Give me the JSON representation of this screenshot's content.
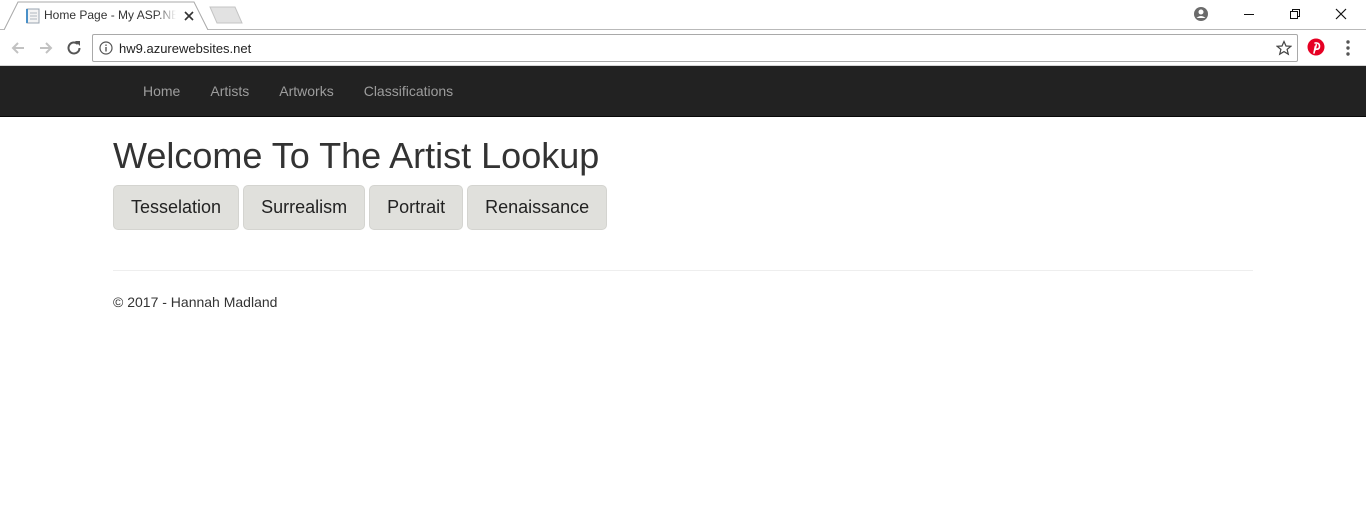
{
  "browser": {
    "tab_title": "Home Page - My ASP.NET Application",
    "url": "hw9.azurewebsites.net",
    "icons": {
      "back": "back-arrow-icon",
      "forward": "forward-arrow-icon",
      "reload": "reload-icon",
      "info": "info-icon",
      "bookmark": "star-icon",
      "extension": "pinterest-icon",
      "menu": "kebab-menu-icon",
      "profile": "profile-icon"
    }
  },
  "navbar": {
    "items": [
      {
        "label": "Home"
      },
      {
        "label": "Artists"
      },
      {
        "label": "Artworks"
      },
      {
        "label": "Classifications"
      }
    ]
  },
  "main": {
    "title": "Welcome To The Artist Lookup",
    "buttons": [
      {
        "label": "Tesselation"
      },
      {
        "label": "Surrealism"
      },
      {
        "label": "Portrait"
      },
      {
        "label": "Renaissance"
      }
    ]
  },
  "footer": {
    "text": "© 2017 - Hannah Madland"
  },
  "colors": {
    "navbar_bg": "#222222",
    "nav_link": "#9d9d9d",
    "button_bg": "#e0e0dc",
    "pinterest": "#e60023"
  }
}
